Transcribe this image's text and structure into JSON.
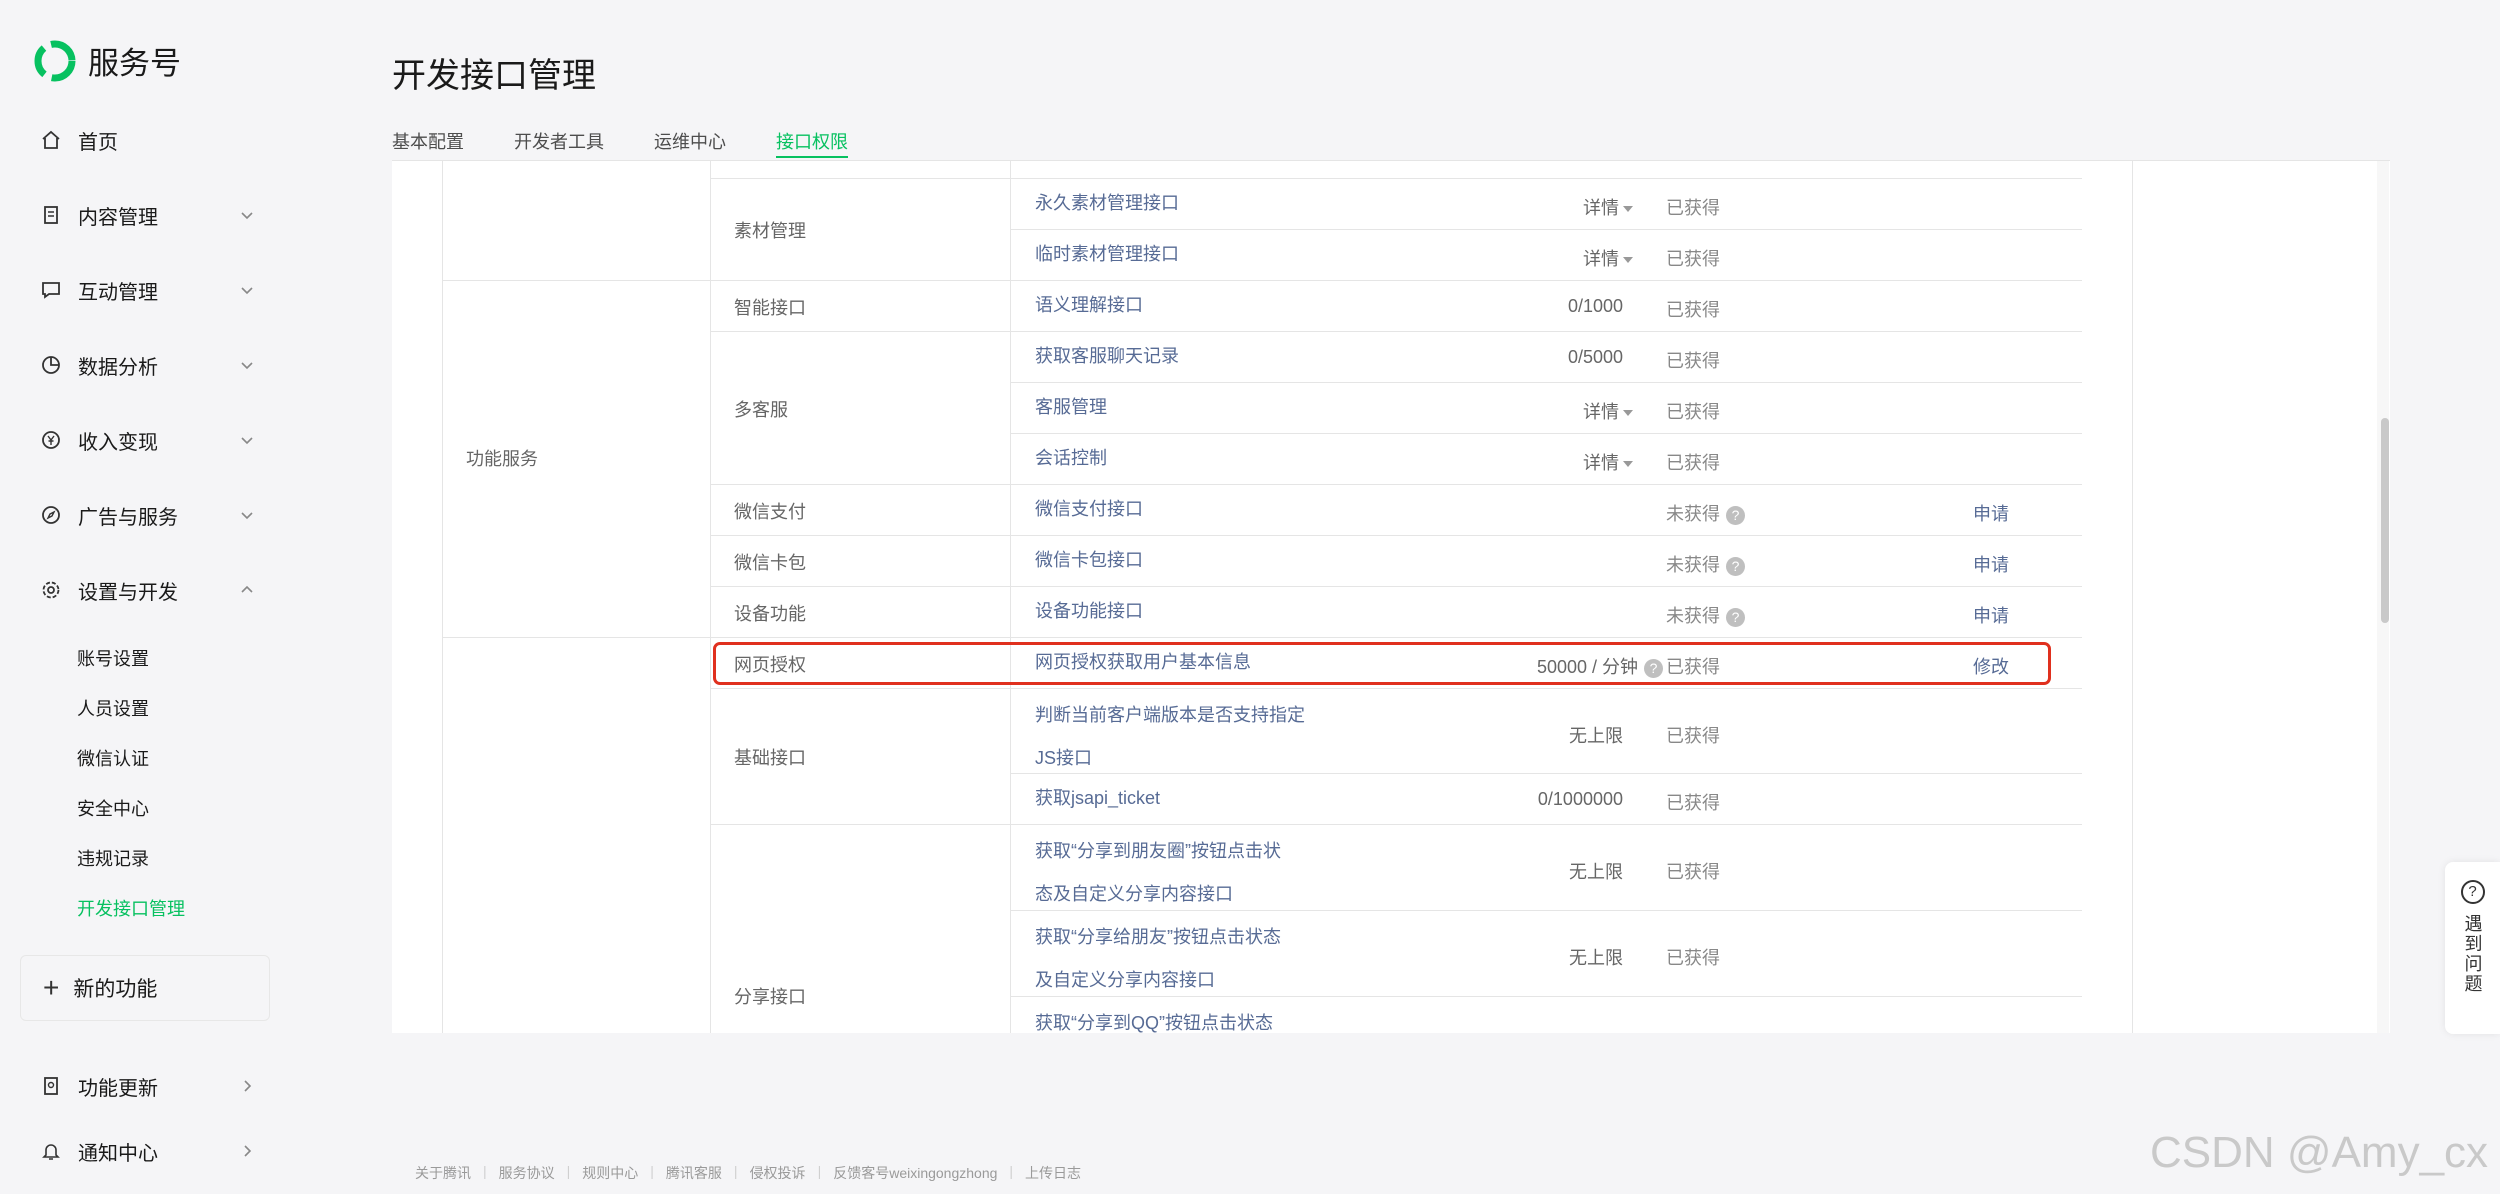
{
  "brand": {
    "name": "服务号"
  },
  "nav": {
    "home": "首页",
    "content": "内容管理",
    "interaction": "互动管理",
    "analytics": "数据分析",
    "monetize": "收入变现",
    "ads": "广告与服务",
    "settings": "设置与开发"
  },
  "settings_sub": [
    "账号设置",
    "人员设置",
    "微信认证",
    "安全中心",
    "违规记录",
    "开发接口管理"
  ],
  "new_function": "新的功能",
  "bottom_nav": {
    "updates": "功能更新",
    "notify": "通知中心"
  },
  "page": {
    "title": "开发接口管理"
  },
  "tabs": [
    "基本配置",
    "开发者工具",
    "运维中心",
    "接口权限"
  ],
  "table": {
    "categories": {
      "func_service": "功能服务"
    },
    "groups": {
      "material": "素材管理",
      "smart": "智能接口",
      "multi_cs": "多客服",
      "pay": "微信支付",
      "card": "微信卡包",
      "device": "设备功能",
      "web_auth": "网页授权",
      "basic": "基础接口",
      "share": "分享接口"
    },
    "rows": [
      {
        "api": "永久素材管理接口",
        "limit": "详情",
        "status": "已获得",
        "action": ""
      },
      {
        "api": "临时素材管理接口",
        "limit": "详情",
        "status": "已获得",
        "action": ""
      },
      {
        "api": "语义理解接口",
        "limit": "0/1000",
        "status": "已获得",
        "action": ""
      },
      {
        "api": "获取客服聊天记录",
        "limit": "0/5000",
        "status": "已获得",
        "action": ""
      },
      {
        "api": "客服管理",
        "limit": "详情",
        "status": "已获得",
        "action": ""
      },
      {
        "api": "会话控制",
        "limit": "详情",
        "status": "已获得",
        "action": ""
      },
      {
        "api": "微信支付接口",
        "limit": "",
        "status": "未获得",
        "action": "申请"
      },
      {
        "api": "微信卡包接口",
        "limit": "",
        "status": "未获得",
        "action": "申请"
      },
      {
        "api": "设备功能接口",
        "limit": "",
        "status": "未获得",
        "action": "申请"
      },
      {
        "api": "网页授权获取用户基本信息",
        "limit": "50000 / 分钟",
        "status": "已获得",
        "action": "修改"
      },
      {
        "api": "判断当前客户端版本是否支持指定JS接口",
        "limit": "无上限",
        "status": "已获得",
        "action": ""
      },
      {
        "api": "获取jsapi_ticket",
        "limit": "0/1000000",
        "status": "已获得",
        "action": ""
      },
      {
        "api": "获取“分享到朋友圈”按钮点击状态及自定义分享内容接口",
        "limit": "无上限",
        "status": "已获得",
        "action": ""
      },
      {
        "api": "获取“分享给朋友”按钮点击状态及自定义分享内容接口",
        "limit": "无上限",
        "status": "已获得",
        "action": ""
      },
      {
        "api": "获取“分享到QQ”按钮点击状态",
        "limit": "",
        "status": "",
        "action": ""
      }
    ]
  },
  "help": {
    "label": "遇到问题"
  },
  "footer": [
    "关于腾讯",
    "服务协议",
    "规则中心",
    "腾讯客服",
    "侵权投诉",
    "反馈客号weixingongzhong",
    "上传日志"
  ],
  "watermark": "CSDN @Amy_cx",
  "colors": {
    "accent": "#07c160",
    "link": "#576b95",
    "highlight": "#e0301e"
  }
}
